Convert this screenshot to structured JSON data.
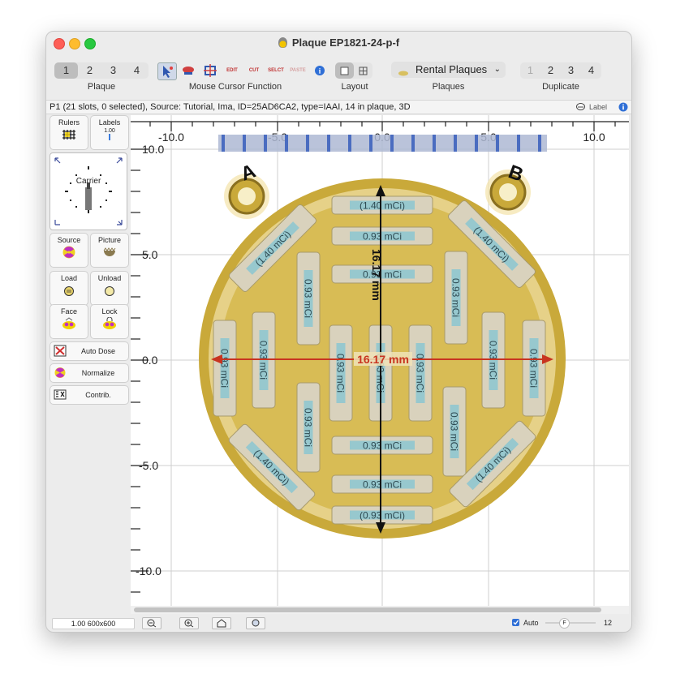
{
  "window": {
    "title": "Plaque EP1821-24-p-f"
  },
  "toolbar": {
    "plaque_tabs": [
      "1",
      "2",
      "3",
      "4"
    ],
    "plaque_label": "Plaque",
    "mouse_label": "Mouse Cursor Function",
    "mouse_tools": [
      {
        "name": "select-arrow-icon",
        "text": ""
      },
      {
        "name": "move-seed-icon",
        "text": ""
      },
      {
        "name": "rotate-icon",
        "text": ""
      },
      {
        "name": "edit-icon",
        "text": "EDIT"
      },
      {
        "name": "cut-icon",
        "text": "CUT"
      },
      {
        "name": "select-icon",
        "text": "SELCT"
      },
      {
        "name": "paste-icon",
        "text": "PASTE"
      },
      {
        "name": "info-icon",
        "text": "i"
      }
    ],
    "layout_label": "Layout",
    "plaques_dropdown": "Rental Plaques",
    "plaques_label": "Plaques",
    "duplicate_tabs": [
      "1",
      "2",
      "3",
      "4"
    ],
    "duplicate_label": "Duplicate"
  },
  "status": {
    "text": "P1 (21 slots, 0 selected), Source: Tutorial, Ima, ID=25AD6CA2, type=IAAI, 14 in plaque, 3D",
    "label_toggle": "Label"
  },
  "sidebar": {
    "rulers": "Rulers",
    "labels": "Labels",
    "labels_value": "1.00",
    "carrier": "Carrier",
    "source": "Source",
    "picture": "Picture",
    "load": "Load",
    "unload": "Unload",
    "face": "Face",
    "lock": "Lock",
    "auto_dose": "Auto Dose",
    "normalize": "Normalize",
    "contrib": "Contrib."
  },
  "canvas": {
    "x_ticks": [
      "-10.0",
      "-5.0",
      "0.0",
      "5.0",
      "10.0"
    ],
    "y_ticks": [
      "10.0",
      "5.0",
      "0.0",
      "-5.0",
      "-10.0"
    ],
    "corner_a": "A",
    "corner_b": "B",
    "vertical_dimension": "16.17 mm",
    "horizontal_dimension": "16.17 mm",
    "seeds": [
      {
        "label": "(1.40 mCi)"
      },
      {
        "label": "0.93 mCi"
      },
      {
        "label": "0.93 mCi"
      },
      {
        "label": "(1.40 mCi)"
      },
      {
        "label": "(1.40 mCi)"
      },
      {
        "label": "0.93 mCi"
      },
      {
        "label": "0.93 mCi"
      },
      {
        "label": "0.93 mCi"
      },
      {
        "label": "0.93 mCi"
      },
      {
        "label": "0.93 mCi"
      },
      {
        "label": "0.93 mCi"
      },
      {
        "label": "0.93 mCi"
      },
      {
        "label": "0.93 mCi"
      },
      {
        "label": "0.93 mCi"
      },
      {
        "label": "(1.40 mCi)"
      },
      {
        "label": "0.93 mCi"
      },
      {
        "label": "0.93 mCi"
      },
      {
        "label": "(1.40 mCi)"
      },
      {
        "label": "0.93 mCi"
      },
      {
        "label": "0.93 mCi"
      },
      {
        "label": "(0.93 mCi)"
      }
    ]
  },
  "bottom": {
    "zoom_text": "1.00 600x600",
    "auto_label": "Auto",
    "slider_letter": "F",
    "slider_value": "12",
    "auto_checked": true
  },
  "colors": {
    "accent": "#3b7bdc",
    "gold": "#c9a93a",
    "dimension_red": "#d23a1a"
  }
}
